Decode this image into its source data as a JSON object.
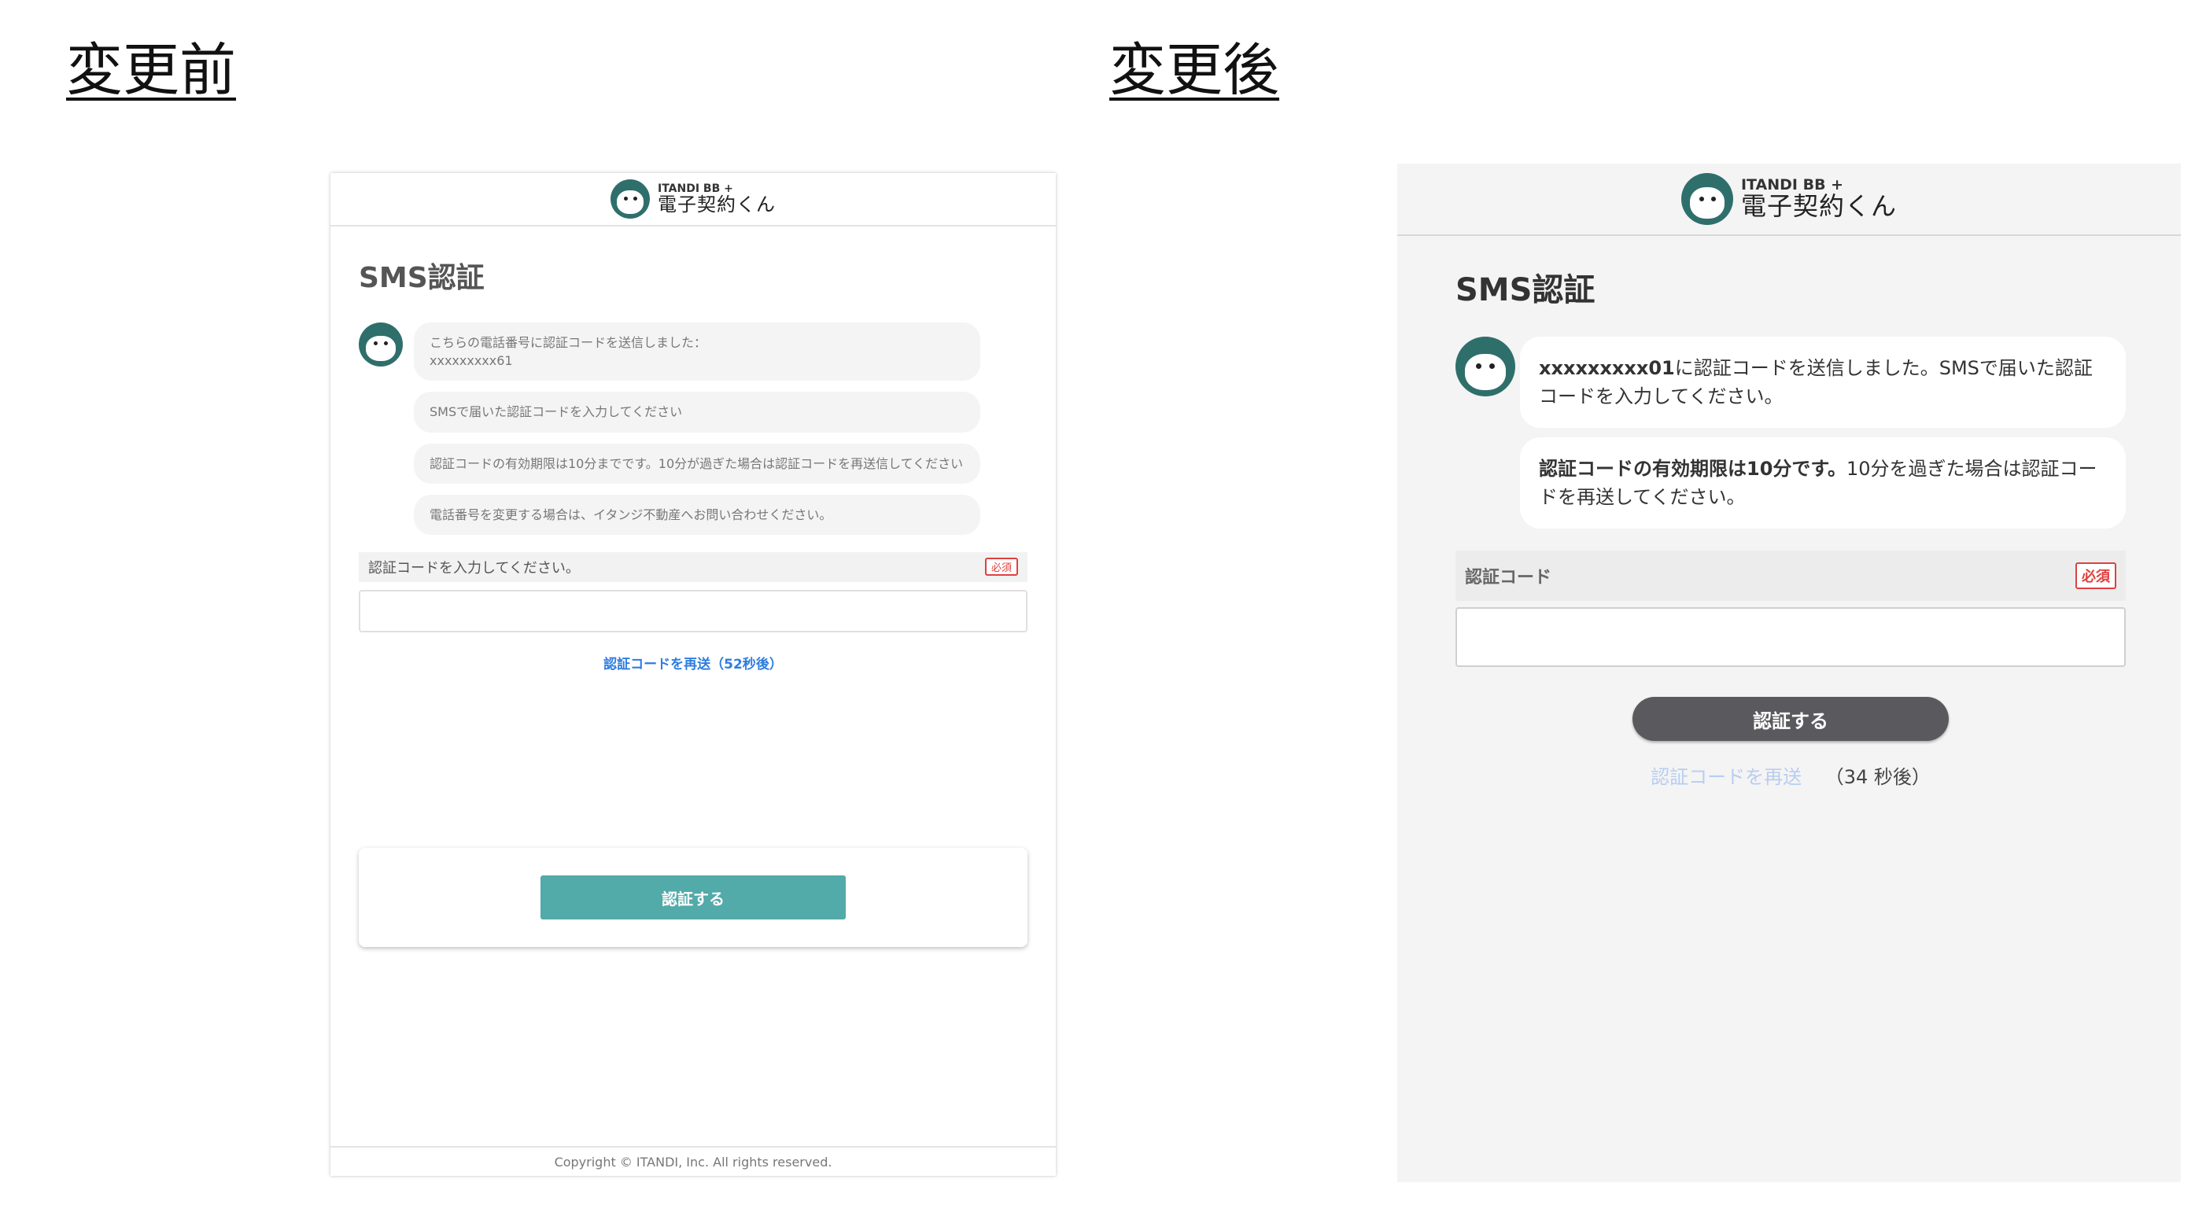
{
  "headings": {
    "before": "変更前",
    "after": "変更後"
  },
  "brand": {
    "sub": "ITANDI BB +",
    "main": "電子契約くん",
    "color": "#2f6f6b"
  },
  "before": {
    "title": "SMS認証",
    "bubbles": [
      "こちらの電話番号に認証コードを送信しました：",
      "xxxxxxxxx61",
      "SMSで届いた認証コードを入力してください",
      "認証コードの有効期限は10分までです。10分が過ぎた場合は認証コードを再送信してください",
      "電話番号を変更する場合は、イタンジ不動産へお問い合わせください。"
    ],
    "field_label": "認証コードを入力してください。",
    "required": "必須",
    "resend": "認証コードを再送（52秒後）",
    "submit": "認証する",
    "submit_color": "#52aaa9",
    "footer": "Copyright © ITANDI, Inc. All rights reserved."
  },
  "after": {
    "title": "SMS認証",
    "bubble1_bold": "xxxxxxxxx01",
    "bubble1_text": "に認証コードを送信しました。SMSで届いた認証コードを入力してください。",
    "bubble2_bold": "認証コードの有効期限は10分です。",
    "bubble2_text": "10分を過ぎた場合は認証コードを再送してください。",
    "field_label": "認証コード",
    "required": "必須",
    "submit": "認証する",
    "submit_color": "#5a5a5e",
    "resend": "認証コードを再送",
    "countdown": "（34 秒後）"
  }
}
